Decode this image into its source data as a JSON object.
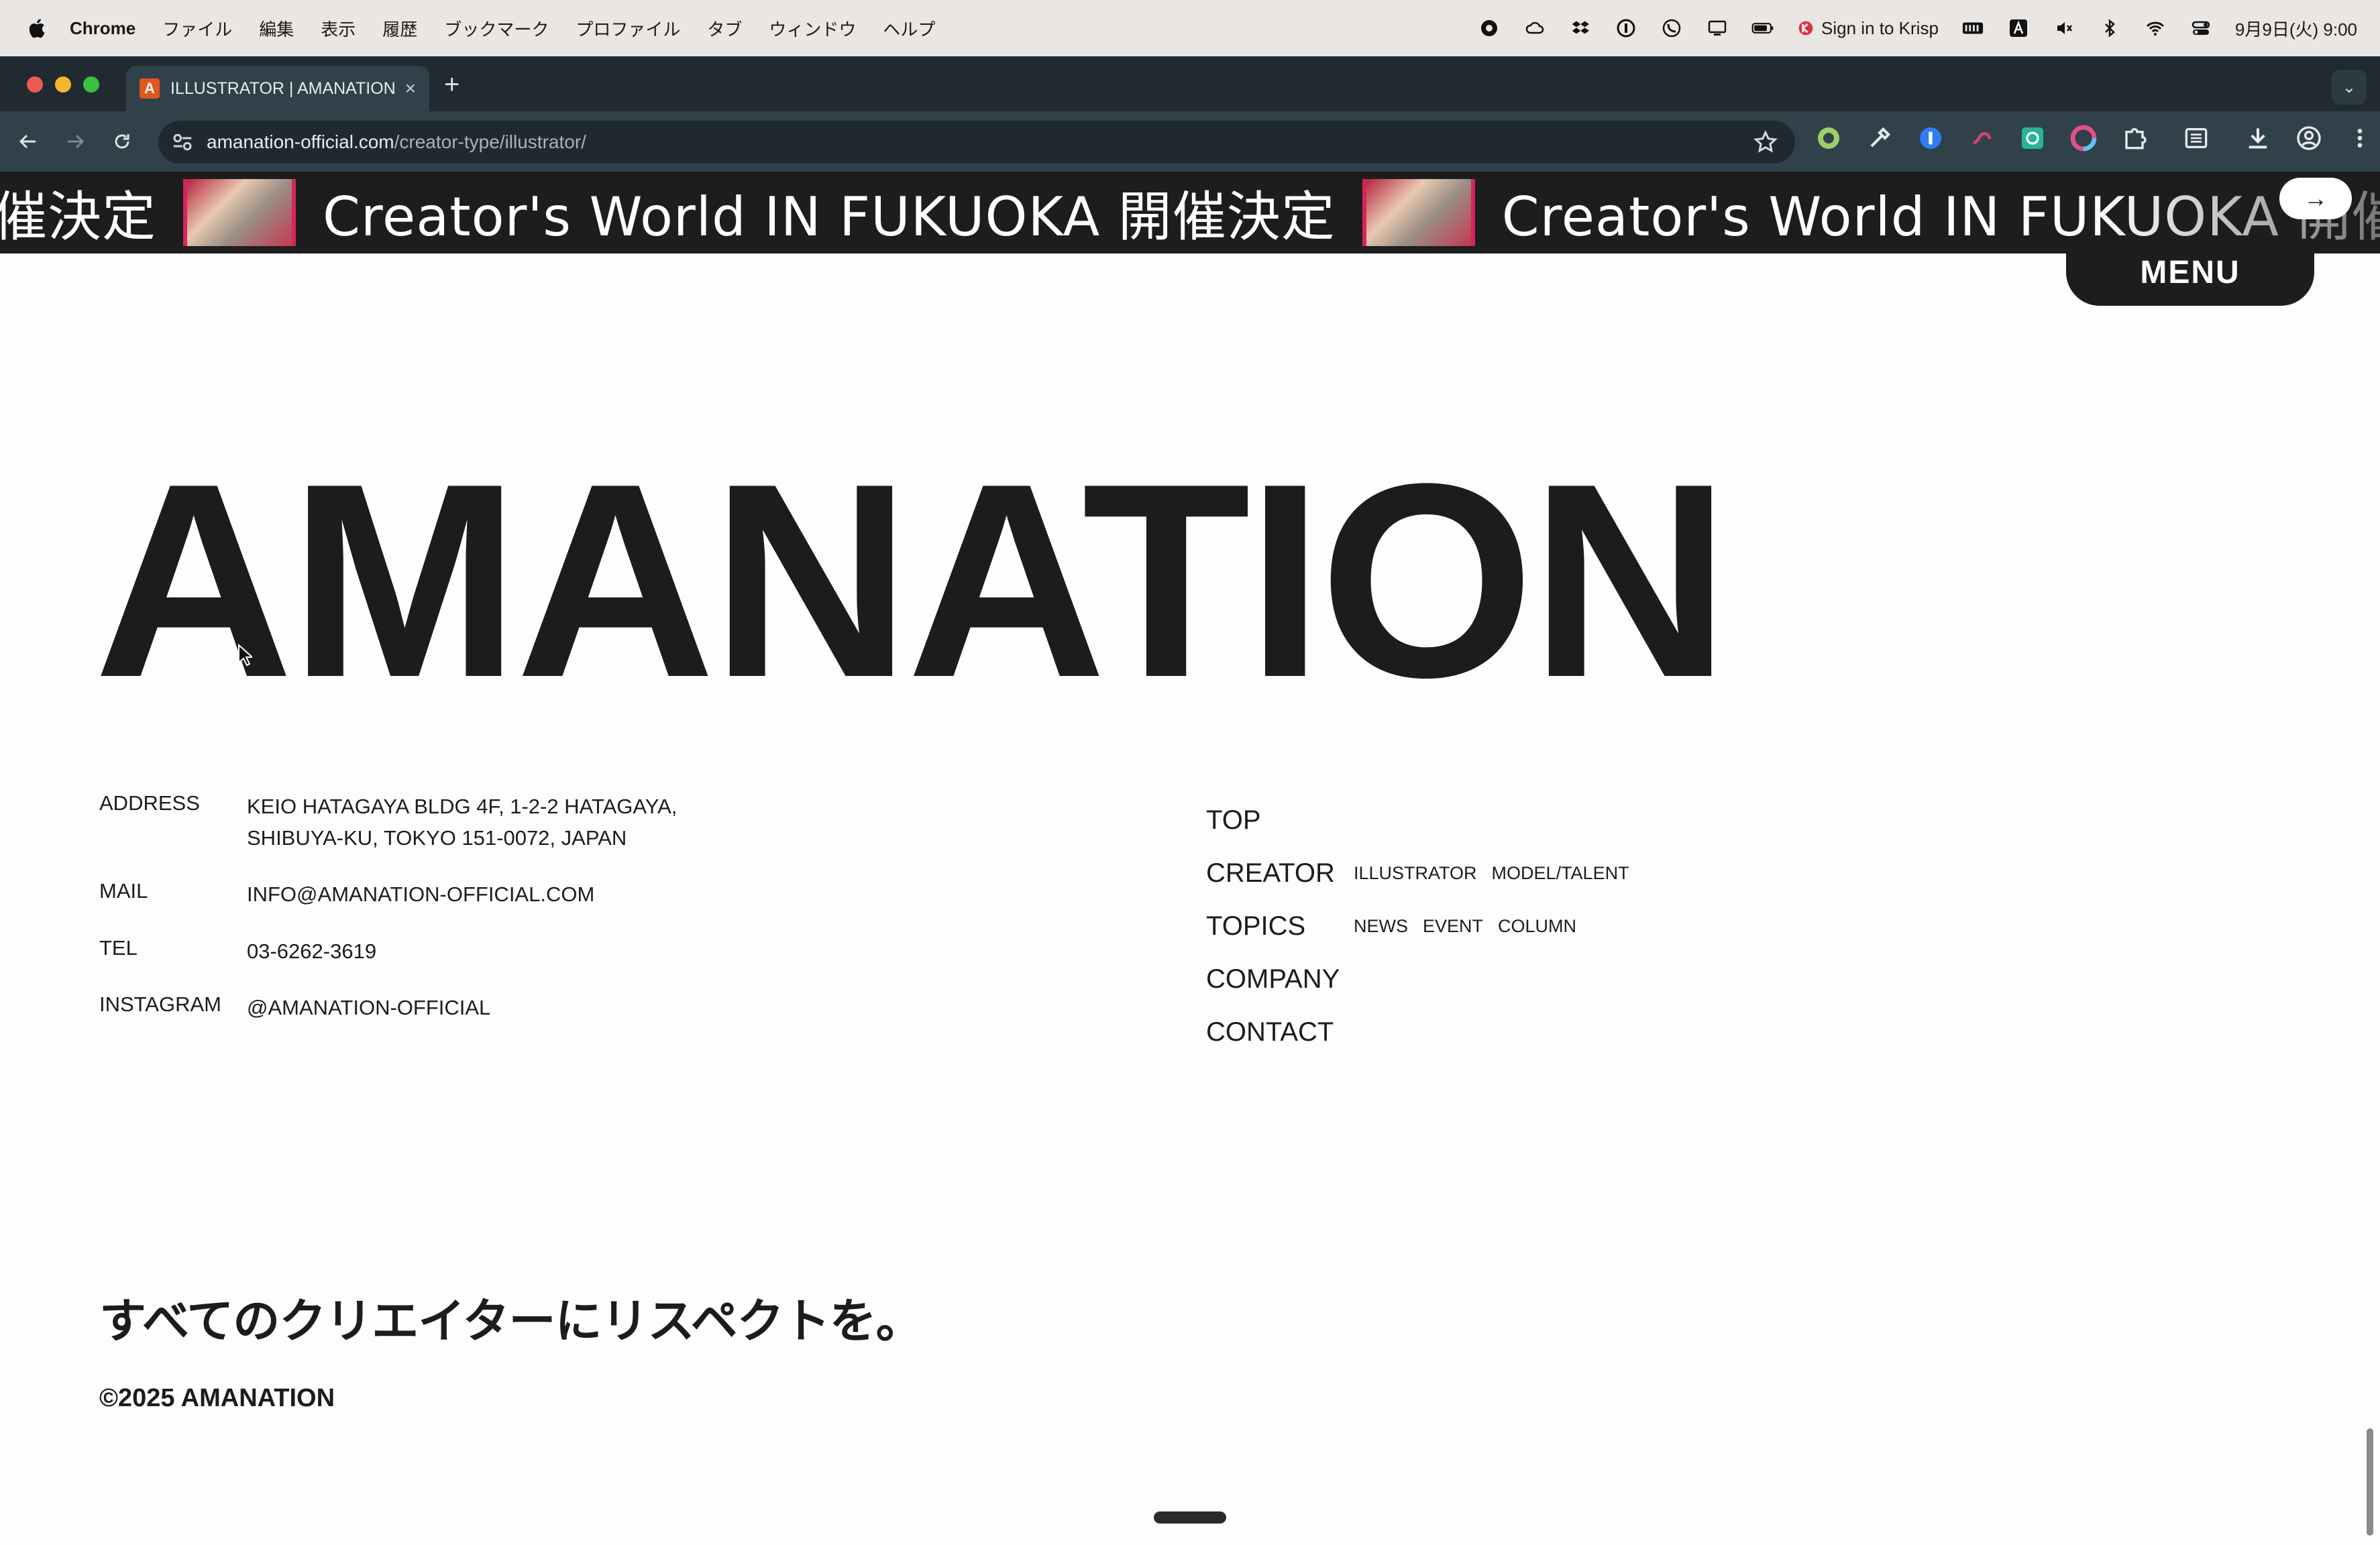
{
  "menubar": {
    "app_name": "Chrome",
    "items": [
      "ファイル",
      "編集",
      "表示",
      "履歴",
      "ブックマーク",
      "プロファイル",
      "タブ",
      "ウィンドウ",
      "ヘルプ"
    ],
    "krisp_label": "Sign in to Krisp",
    "datetime": "9月9日(火) 9:00"
  },
  "browser": {
    "tab_title": "ILLUSTRATOR | AMANATION",
    "favicon_letter": "A",
    "url_host": "amanation-official.com",
    "url_path": "/creator-type/illustrator/"
  },
  "ticker": {
    "prefix": "催決定",
    "text": "Creator's World IN FUKUOKA 開催決定",
    "button": "→"
  },
  "menu_button": "MENU",
  "logo": "AMANATION",
  "info": {
    "address_label": "ADDRESS",
    "address_line1": "KEIO HATAGAYA BLDG 4F, 1-2-2 HATAGAYA,",
    "address_line2": "SHIBUYA-KU, TOKYO 151-0072, JAPAN",
    "mail_label": "MAIL",
    "mail_value": "INFO@AMANATION-OFFICIAL.COM",
    "tel_label": "TEL",
    "tel_value": "03-6262-3619",
    "instagram_label": "INSTAGRAM",
    "instagram_value": "@AMANATION-OFFICIAL"
  },
  "nav": {
    "top": "TOP",
    "creator": "CREATOR",
    "creator_subs": [
      "ILLUSTRATOR",
      "MODEL/TALENT"
    ],
    "topics": "TOPICS",
    "topics_subs": [
      "NEWS",
      "EVENT",
      "COLUMN"
    ],
    "company": "COMPANY",
    "contact": "CONTACT"
  },
  "tagline": "すべてのクリエイターにリスペクトを。",
  "copyright": "©2025 AMANATION",
  "colors": {
    "menubar_bg": "#e9e6e3",
    "tabstrip_bg": "#202a30",
    "toolbar_bg": "#31414a",
    "ticker_bg": "#1d1d1d",
    "accent_pink": "#d5255a",
    "text_dark": "#1c1c1c"
  }
}
